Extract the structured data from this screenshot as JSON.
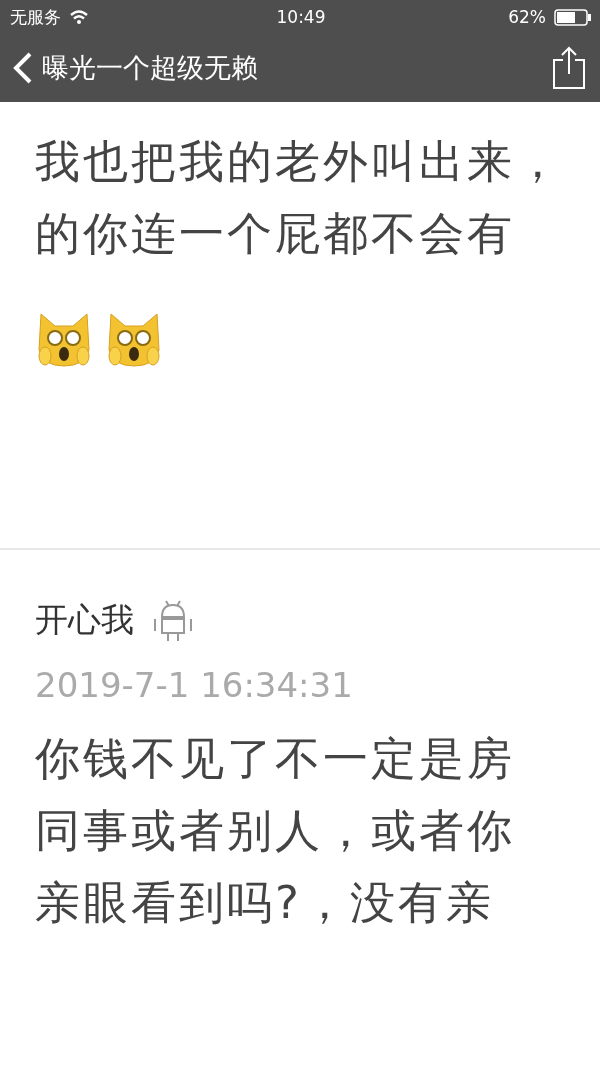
{
  "status_bar": {
    "carrier": "无服务",
    "time": "10:49",
    "battery": "62%"
  },
  "nav_bar": {
    "title": "曝光一个超级无赖"
  },
  "comments": [
    {
      "kind": "tail",
      "lines": [
        "我也把我的老外叫出来，",
        "的你连一个屁都不会有"
      ],
      "emojis": [
        {
          "kind": "screaming-cat"
        },
        {
          "kind": "screaming-cat"
        }
      ]
    },
    {
      "kind": "full",
      "author": "开心我",
      "time": "2019-7-1 16:34:31",
      "lines": [
        "你钱不见了不一定是房",
        "同事或者别人，或者你",
        "亲眼看到吗?，没有亲"
      ]
    }
  ]
}
